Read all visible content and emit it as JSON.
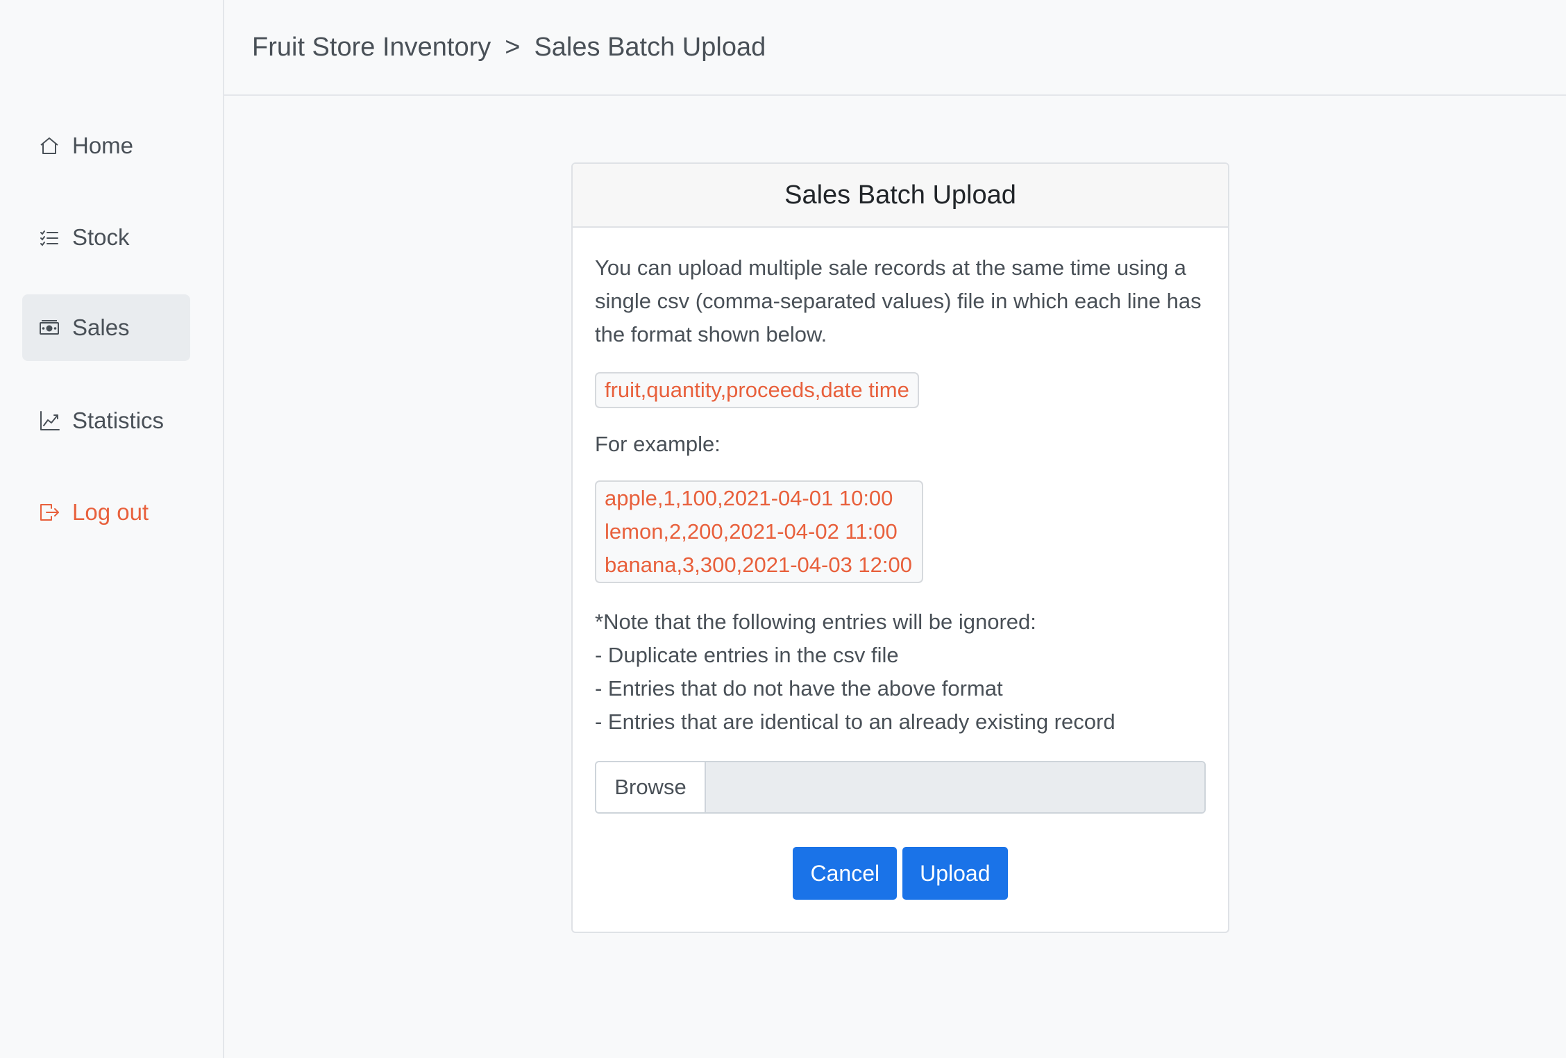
{
  "breadcrumb": {
    "root": "Fruit Store Inventory",
    "separator": ">",
    "current": "Sales Batch Upload"
  },
  "sidebar": {
    "items": [
      {
        "label": "Home",
        "icon": "home-icon"
      },
      {
        "label": "Stock",
        "icon": "list-icon"
      },
      {
        "label": "Sales",
        "icon": "cash-icon",
        "active": true
      },
      {
        "label": "Statistics",
        "icon": "chart-icon"
      },
      {
        "label": "Log out",
        "icon": "logout-icon",
        "color": "#e8603c"
      }
    ]
  },
  "card": {
    "title": "Sales Batch Upload",
    "intro": "You can upload multiple sale records at the same time using a single csv (comma-separated values) file in which each line has the format shown below.",
    "format": "fruit,quantity,proceeds,date time",
    "example_label": "For example:",
    "examples": [
      "apple,1,100,2021-04-01 10:00",
      "lemon,2,200,2021-04-02 11:00",
      "banana,3,300,2021-04-03 12:00"
    ],
    "notes": [
      "*Note that the following entries will be ignored:",
      "- Duplicate entries in the csv file",
      "- Entries that do not have the above format",
      "- Entries that are identical to an already existing record"
    ],
    "browse_label": "Browse",
    "file_name": "",
    "cancel_label": "Cancel",
    "upload_label": "Upload"
  },
  "colors": {
    "accent": "#1a73e8",
    "code": "#e8603c",
    "logout": "#e8603c"
  }
}
